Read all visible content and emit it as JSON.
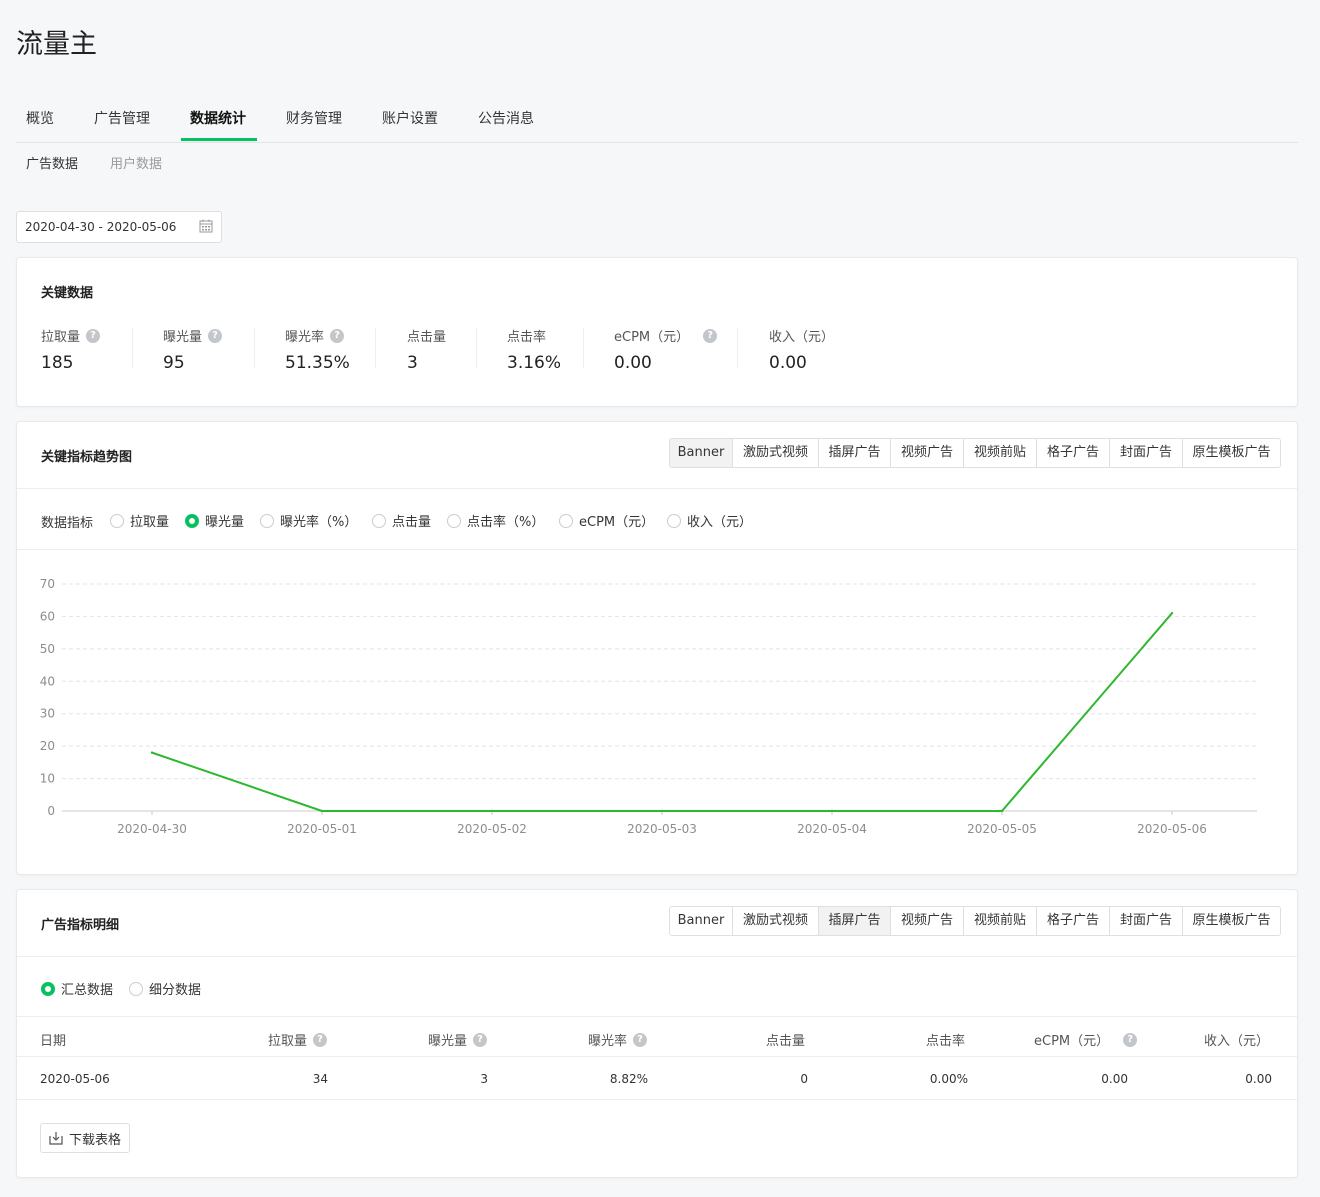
{
  "app_title": "流量主",
  "nav": {
    "items": [
      "概览",
      "广告管理",
      "数据统计",
      "财务管理",
      "账户设置",
      "公告消息"
    ],
    "active": "数据统计"
  },
  "subnav": {
    "items": [
      "广告数据",
      "用户数据"
    ],
    "active": "广告数据"
  },
  "date_range": {
    "value": "2020-04-30 - 2020-05-06",
    "icon": "calendar-icon"
  },
  "key_data": {
    "title": "关键数据",
    "metrics": [
      {
        "label": "拉取量",
        "value": "185",
        "help": true
      },
      {
        "label": "曝光量",
        "value": "95",
        "help": true
      },
      {
        "label": "曝光率",
        "value": "51.35%",
        "help": true
      },
      {
        "label": "点击量",
        "value": "3",
        "help": false
      },
      {
        "label": "点击率",
        "value": "3.16%",
        "help": false
      },
      {
        "label": "eCPM（元）",
        "value": "0.00",
        "help": true
      },
      {
        "label": "收入（元）",
        "value": "0.00",
        "help": false
      }
    ]
  },
  "ad_tabs": [
    "Banner",
    "激励式视频",
    "插屏广告",
    "视频广告",
    "视频前贴",
    "格子广告",
    "封面广告",
    "原生模板广告"
  ],
  "trend": {
    "title": "关键指标趋势图",
    "active_tab": "Banner",
    "metric_label": "数据指标",
    "metrics": [
      "拉取量",
      "曝光量",
      "曝光率（%）",
      "点击量",
      "点击率（%）",
      "eCPM（元）",
      "收入（元）"
    ],
    "selected_metric": "曝光量"
  },
  "chart_data": {
    "type": "line",
    "x": [
      "2020-04-30",
      "2020-05-01",
      "2020-05-02",
      "2020-05-03",
      "2020-05-04",
      "2020-05-05",
      "2020-05-06"
    ],
    "series": [
      {
        "values": [
          18,
          0,
          0,
          0,
          0,
          0,
          61
        ],
        "color": "#2eb82e"
      }
    ],
    "yticks": [
      0,
      10,
      20,
      30,
      40,
      50,
      60,
      70
    ],
    "ylim": [
      0,
      70
    ],
    "grid": true
  },
  "detail": {
    "title": "广告指标明细",
    "active_tab": "插屏广告",
    "view_options": [
      "汇总数据",
      "细分数据"
    ],
    "selected_view": "汇总数据",
    "columns": [
      {
        "label": "日期",
        "help": false
      },
      {
        "label": "拉取量",
        "help": true
      },
      {
        "label": "曝光量",
        "help": true
      },
      {
        "label": "曝光率",
        "help": true
      },
      {
        "label": "点击量",
        "help": false
      },
      {
        "label": "点击率",
        "help": false
      },
      {
        "label": "eCPM（元）",
        "help": true
      },
      {
        "label": "收入（元）",
        "help": false
      }
    ],
    "rows": [
      [
        "2020-05-06",
        "34",
        "3",
        "8.82%",
        "0",
        "0.00%",
        "0.00",
        "0.00"
      ]
    ],
    "download_label": "下载表格"
  }
}
